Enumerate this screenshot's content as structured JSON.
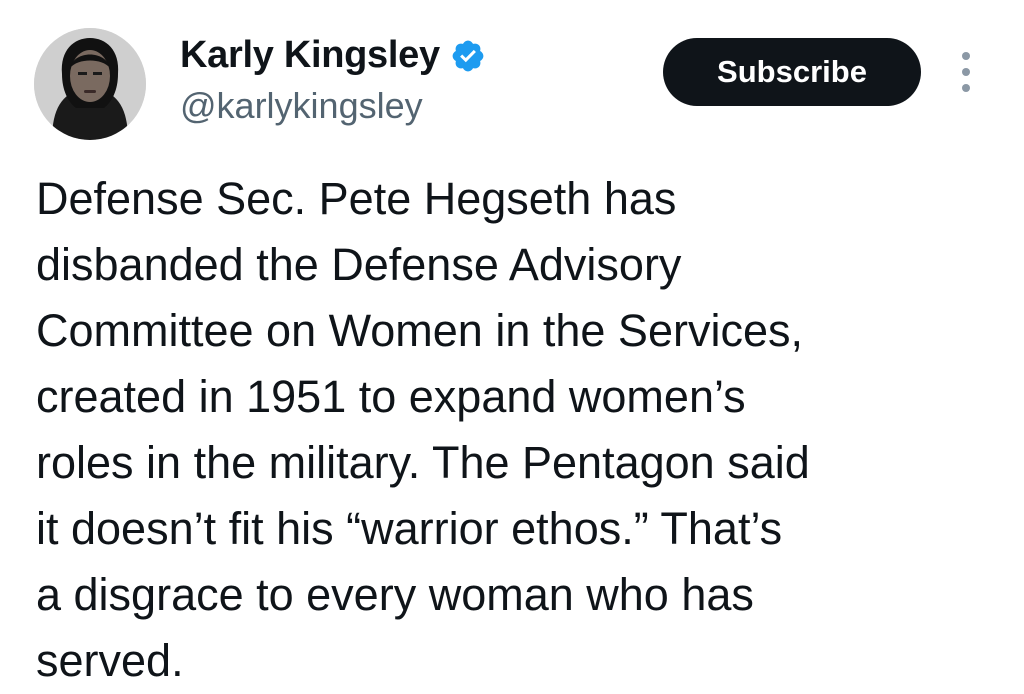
{
  "author": {
    "display_name": "Karly Kingsley",
    "handle": "@karlykingsley",
    "verified_icon": "verified-badge-icon",
    "badge_color": "#1d9bf0"
  },
  "actions": {
    "subscribe_label": "Subscribe",
    "more_icon": "more-options-icon"
  },
  "tweet": {
    "lines": [
      "Defense Sec. Pete Hegseth has",
      "disbanded the Defense Advisory",
      "Committee on Women in the Services,",
      "created in 1951 to expand women’s",
      "roles in the military. The Pentagon said",
      "it doesn’t fit his “warrior ethos.” That’s",
      "a disgrace to every woman who has",
      "served."
    ]
  }
}
